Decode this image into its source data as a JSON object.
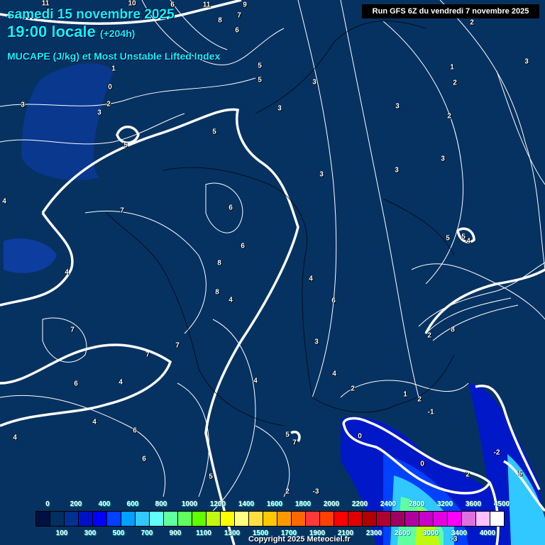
{
  "header": {
    "date": "samedi 15 novembre 2025",
    "time": "19:00 locale",
    "lead": "(+204h)",
    "parameter": "MUCAPE (J/kg) et Most Unstable Lifted Index",
    "run": "Run GFS 6Z du vendredi 7 novembre 2025"
  },
  "colors": {
    "background": "#063261",
    "contour": "#ffffff",
    "title": "#00ffff"
  },
  "colorbar": {
    "colors": [
      "#001040",
      "#003060",
      "#003090",
      "#0010c8",
      "#0000ff",
      "#0040ff",
      "#00a0ff",
      "#30c8ff",
      "#60ffff",
      "#60ffa0",
      "#60ff60",
      "#60ff00",
      "#c0f810",
      "#ffff00",
      "#ffff80",
      "#ffe040",
      "#ffc800",
      "#ff9800",
      "#ff6800",
      "#ff3838",
      "#ff4000",
      "#ff0000",
      "#e00000",
      "#b00000",
      "#b00030",
      "#a00060",
      "#b000a0",
      "#c800c8",
      "#e000e0",
      "#ff00ff",
      "#e070e0",
      "#ffc0ff",
      "#ffffff"
    ],
    "top_labels": [
      "0",
      "200",
      "400",
      "600",
      "800",
      "1000",
      "1200",
      "1400",
      "1600",
      "1800",
      "2000",
      "2200",
      "2400",
      "2800",
      "3200",
      "3600",
      "4500"
    ],
    "bottom_labels": [
      "100",
      "300",
      "500",
      "700",
      "900",
      "1100",
      "1300",
      "1500",
      "1700",
      "1900",
      "2100",
      "2300",
      "2600",
      "3000",
      "3400",
      "4000"
    ]
  },
  "contour_labels": [
    "11",
    "10",
    "6",
    "11",
    "9",
    "7",
    "8",
    "6",
    "5",
    "5",
    "1",
    "0",
    "2",
    "3",
    "3",
    "5",
    "5",
    "3",
    "3",
    "2",
    "1",
    "2",
    "3",
    "3",
    "2",
    "3",
    "3",
    "3",
    "7",
    "6",
    "6",
    "8",
    "8",
    "4",
    "4",
    "4",
    "4",
    "6",
    "5",
    "5",
    "4",
    "7",
    "7",
    "7",
    "6",
    "4",
    "6",
    "4",
    "6",
    "5",
    "4",
    "4",
    "4",
    "3",
    "2",
    "2",
    "1",
    "-1",
    "0",
    "0",
    "2",
    "-2",
    "5",
    "5",
    "7",
    "8",
    "2",
    "2",
    "-3",
    "-3"
  ],
  "copyright": "Copyright 2025 Meteociel.fr"
}
